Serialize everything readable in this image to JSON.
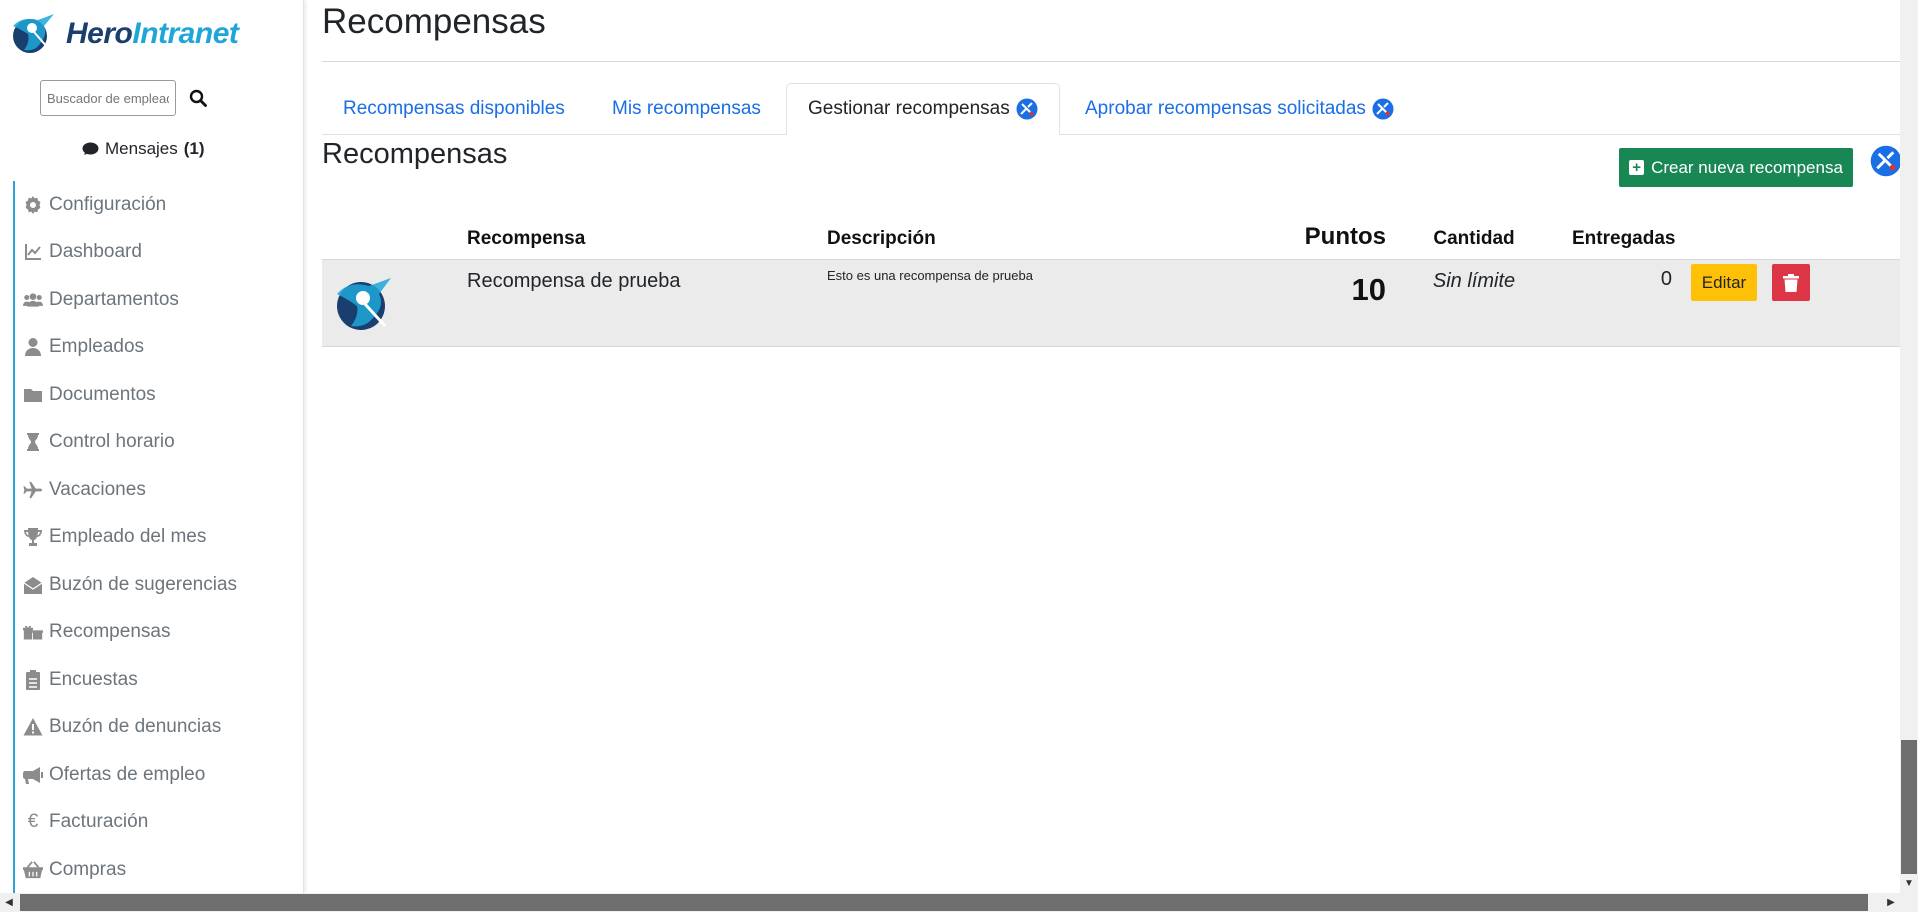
{
  "brand": {
    "name_part1": "Hero",
    "name_part2": "Intranet"
  },
  "search": {
    "placeholder": "Buscador de empleados..."
  },
  "messages": {
    "label": "Mensajes",
    "count": "(1)"
  },
  "sidebar": {
    "items": [
      {
        "label": "Configuración",
        "icon": "gear-icon"
      },
      {
        "label": "Dashboard",
        "icon": "chart-line-icon"
      },
      {
        "label": "Departamentos",
        "icon": "users-icon"
      },
      {
        "label": "Empleados",
        "icon": "user-icon"
      },
      {
        "label": "Documentos",
        "icon": "folder-icon"
      },
      {
        "label": "Control horario",
        "icon": "hourglass-icon"
      },
      {
        "label": "Vacaciones",
        "icon": "plane-icon"
      },
      {
        "label": "Empleado del mes",
        "icon": "trophy-icon"
      },
      {
        "label": "Buzón de sugerencias",
        "icon": "envelope-open-icon"
      },
      {
        "label": "Recompensas",
        "icon": "gifts-icon"
      },
      {
        "label": "Encuestas",
        "icon": "clipboard-list-icon"
      },
      {
        "label": "Buzón de denuncias",
        "icon": "warning-icon"
      },
      {
        "label": "Ofertas de empleo",
        "icon": "megaphone-icon"
      },
      {
        "label": "Facturación",
        "icon": "euro-icon"
      },
      {
        "label": "Compras",
        "icon": "basket-icon"
      }
    ]
  },
  "page": {
    "title": "Recompensas",
    "section_title": "Recompensas"
  },
  "tabs": [
    {
      "label": "Recompensas disponibles",
      "active": false
    },
    {
      "label": "Mis recompensas",
      "active": false
    },
    {
      "label": "Gestionar recompensas",
      "active": true
    },
    {
      "label": "Aprobar recompensas solicitadas",
      "active": false
    }
  ],
  "actions": {
    "create_label": "Crear nueva recompensa"
  },
  "table": {
    "headers": {
      "reward": "Recompensa",
      "description": "Descripción",
      "points": "Puntos",
      "quantity": "Cantidad",
      "delivered": "Entregadas"
    },
    "rows": [
      {
        "name": "Recompensa de prueba",
        "description": "Esto es una recompensa de prueba",
        "points": "10",
        "quantity": "Sin límite",
        "delivered": "0",
        "edit_label": "Editar"
      }
    ]
  },
  "colors": {
    "accent": "#1a6ee6",
    "success": "#198754",
    "warning": "#ffc107",
    "danger": "#dc3545",
    "brand_dark": "#1a3e6e",
    "brand_light": "#1fa6d8"
  }
}
